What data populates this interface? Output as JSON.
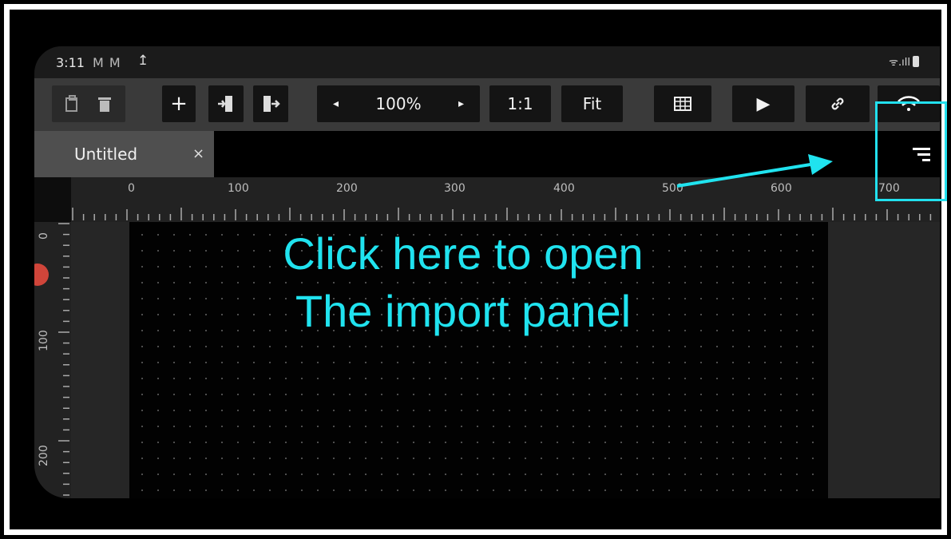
{
  "status_bar": {
    "time": "3:11",
    "notification_icons": "M M",
    "upload_icon": "↥",
    "signal_text": "ᯤ.ıll"
  },
  "toolbar": {
    "zoom_level": "100%",
    "zoom_prev": "◂",
    "zoom_next": "▸",
    "actual_size_label": "1:1",
    "fit_label": "Fit",
    "add_label": "+",
    "play_label": "▶",
    "link_label": "🔗"
  },
  "tabs": [
    {
      "label": "Untitled",
      "close": "×"
    }
  ],
  "ruler": {
    "horizontal_ticks": [
      "0",
      "100",
      "200",
      "300",
      "400",
      "500",
      "600",
      "700"
    ],
    "vertical_ticks": [
      "0",
      "100",
      "200"
    ]
  },
  "annotation": {
    "line1": "Click here to open",
    "line2": "The import panel",
    "color": "#20e3ef"
  },
  "icons": [
    "paste-icon",
    "trash-icon",
    "add-icon",
    "import-icon",
    "export-icon",
    "zoom-prev-icon",
    "zoom-next-icon",
    "grid-icon",
    "play-icon",
    "link-icon",
    "wifi-icon",
    "menu-icon"
  ]
}
